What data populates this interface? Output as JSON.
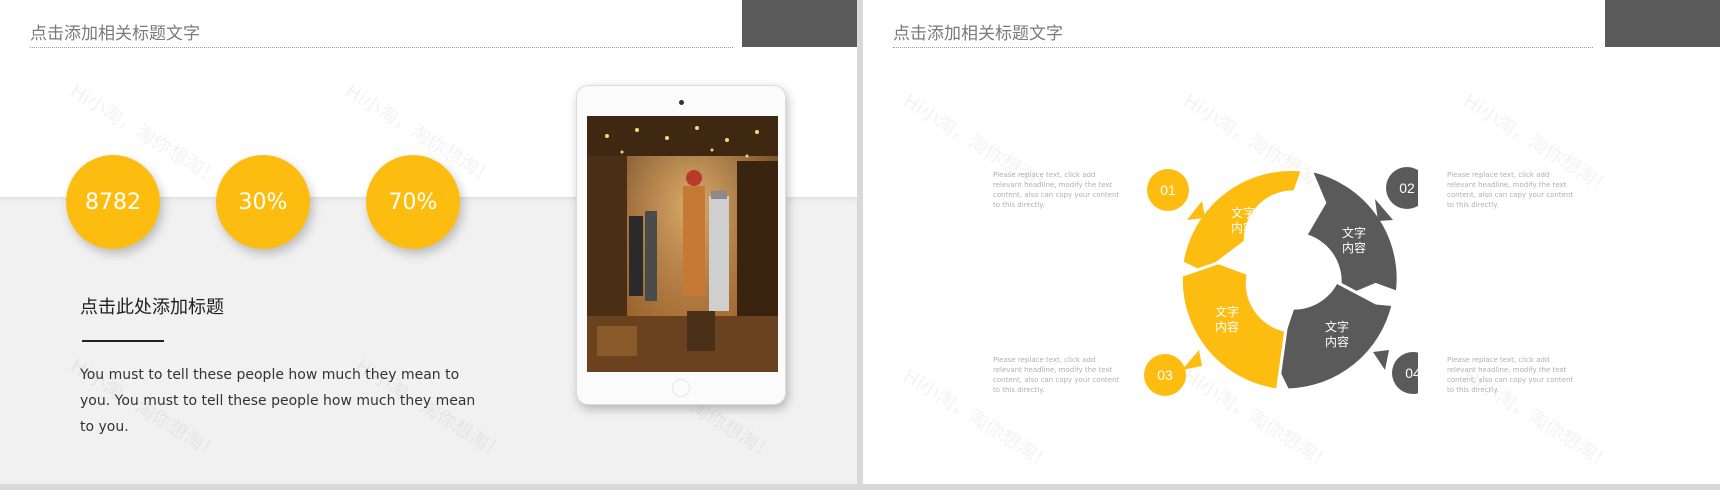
{
  "colors": {
    "accent": "#FDBD10",
    "dark": "#5a5a5a",
    "band": "#f1f1f1"
  },
  "watermark_text": "Hi小淘，淘你想淘！",
  "left_slide": {
    "title": "点击添加相关标题文字",
    "stats": [
      "8782",
      "30%",
      "70%"
    ],
    "subtitle": "点击此处添加标题",
    "body": "You must to tell these people how much they mean to you. You must to tell these people how much they mean to you."
  },
  "right_slide": {
    "title": "点击添加相关标题文字",
    "descriptions": [
      "Please replace text, click add relevant headline, modify the text content, also can copy your content to this directly.",
      "Please replace text, click add relevant headline, modify the text content, also can copy your content to this directly.",
      "Please replace text, click add relevant headline, modify the text content, also can copy your content to this directly.",
      "Please replace text, click add relevant headline, modify the text content, also can copy your content to this directly."
    ],
    "cycle": {
      "segments": [
        {
          "line1": "文字",
          "line2": "内容"
        },
        {
          "line1": "文字",
          "line2": "内容"
        },
        {
          "line1": "文字",
          "line2": "内容"
        },
        {
          "line1": "文字",
          "line2": "内容"
        }
      ],
      "numbers": [
        "01",
        "02",
        "03",
        "04"
      ]
    }
  }
}
